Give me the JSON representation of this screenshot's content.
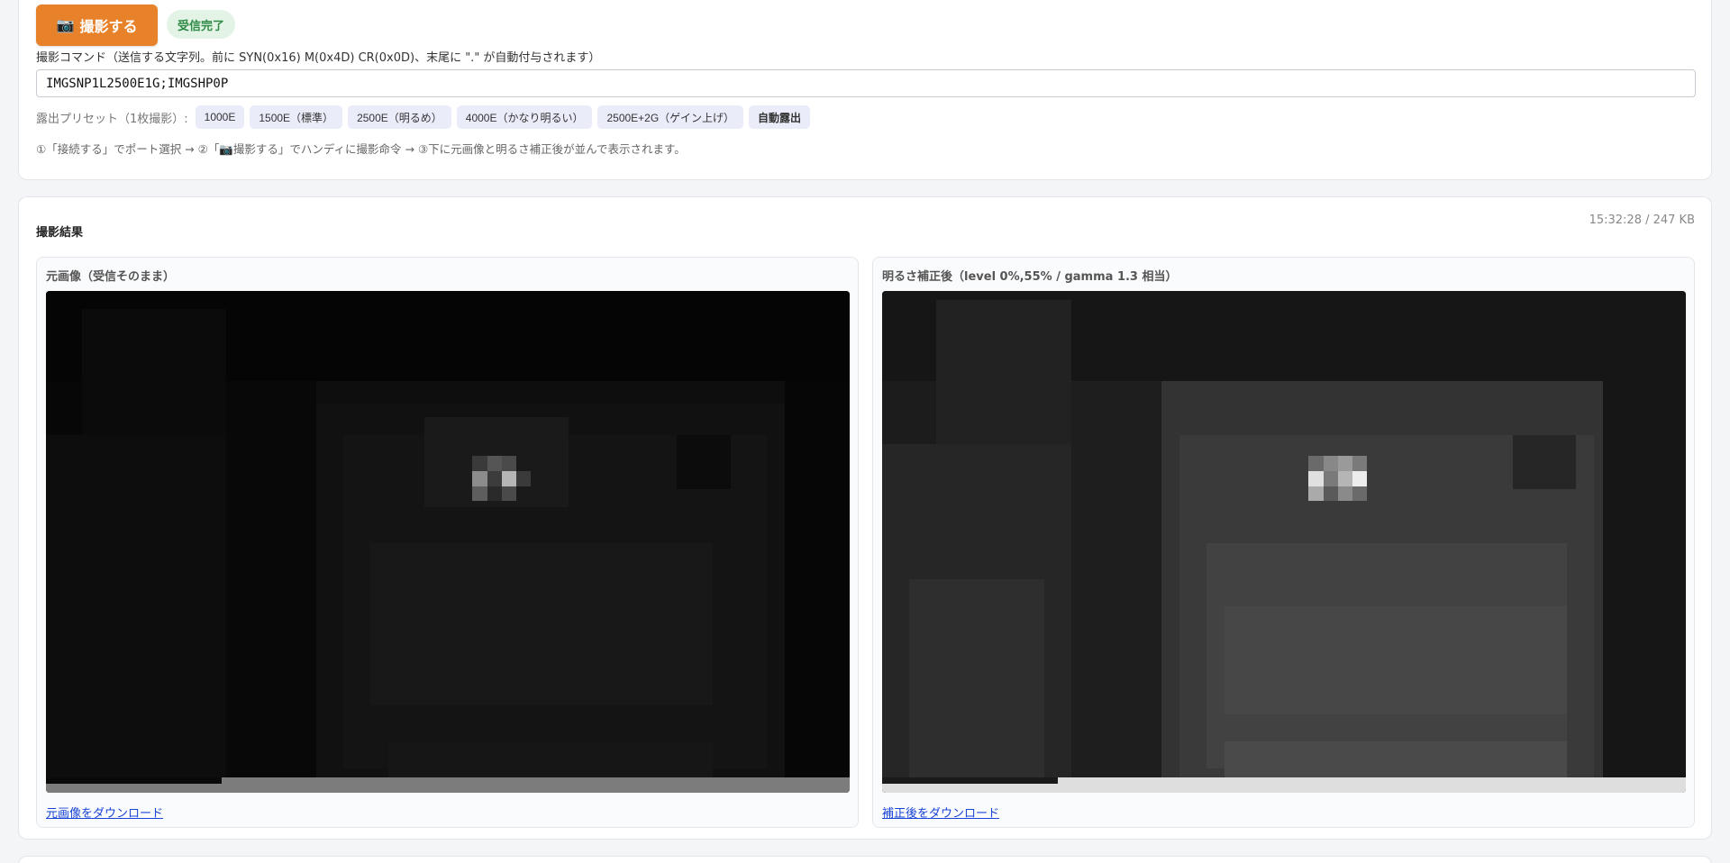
{
  "toolbar": {
    "capture_icon": "📷",
    "capture_label": "撮影する",
    "status": "受信完了"
  },
  "command": {
    "label": "撮影コマンド（送信する文字列。前に SYN(0x16) M(0x4D) CR(0x0D)、末尾に \".\" が自動付与されます）",
    "value": "IMGSNP1L2500E1G;IMGSHP0P"
  },
  "presets": {
    "label": "露出プリセット（1枚撮影）:",
    "items": [
      {
        "label": "1000E",
        "bold": false
      },
      {
        "label": "1500E（標準）",
        "bold": false
      },
      {
        "label": "2500E（明るめ）",
        "bold": false
      },
      {
        "label": "4000E（かなり明るい）",
        "bold": false
      },
      {
        "label": "2500E+2G（ゲイン上げ）",
        "bold": false
      },
      {
        "label": "自動露出",
        "bold": true
      }
    ]
  },
  "hint": "①「接続する」でポート選択 → ②「📷撮影する」でハンディに撮影命令 → ③下に元画像と明るさ補正後が並んで表示されます。",
  "result": {
    "title": "撮影結果",
    "meta": "15:32:28 / 247 KB",
    "original": {
      "title": "元画像（受信そのまま）",
      "download": "元画像をダウンロード"
    },
    "corrected": {
      "title": "明るさ補正後（level 0%,55% / gamma 1.3 相当）",
      "download": "補正後をダウンロード"
    }
  },
  "colors": {
    "accent": "#e8822a",
    "status_bg": "#e3f4e7",
    "status_fg": "#2f8a45",
    "link": "#1a44d6",
    "preset_bg": "#eaecfa"
  }
}
